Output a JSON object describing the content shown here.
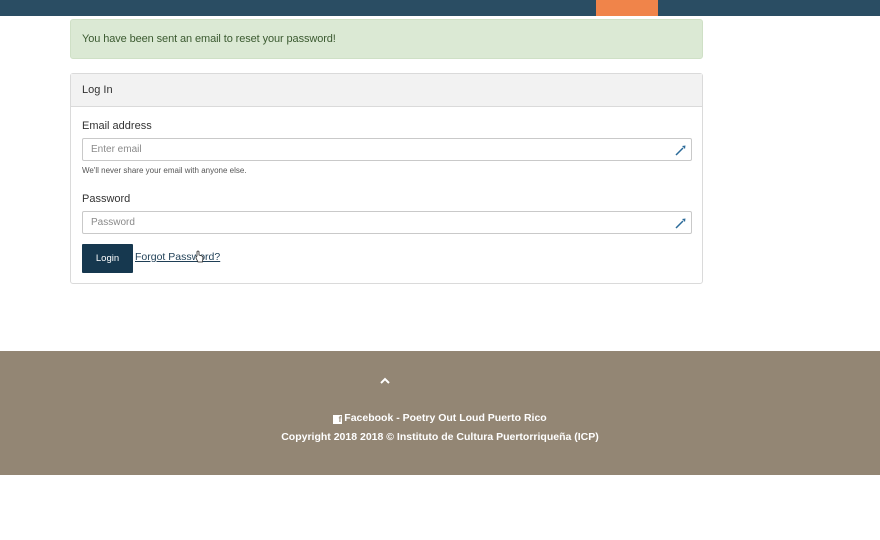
{
  "alert": {
    "message": "You have been sent an email to reset your password!"
  },
  "card": {
    "header": "Log In",
    "email": {
      "label": "Email address",
      "placeholder": "Enter email",
      "help": "We'll never share your email with anyone else."
    },
    "password": {
      "label": "Password",
      "placeholder": "Password"
    },
    "login_label": "Login",
    "forgot_label": "Forgot Password?"
  },
  "footer": {
    "facebook_label": "Facebook - Poetry Out Loud Puerto Rico",
    "copyright": "Copyright 2018 2018 © Instituto de Cultura Puertorriqueña (ICP)"
  },
  "icons": {
    "key": "key-icon",
    "facebook": "facebook-icon",
    "scroll_top": "chevron-up-icon",
    "cursor": "cursor-icon"
  },
  "colors": {
    "topbar": "#2a4d63",
    "accent": "#f0844a",
    "alert_bg": "#dbe9d4",
    "button": "#16384f",
    "footer": "#938674"
  }
}
